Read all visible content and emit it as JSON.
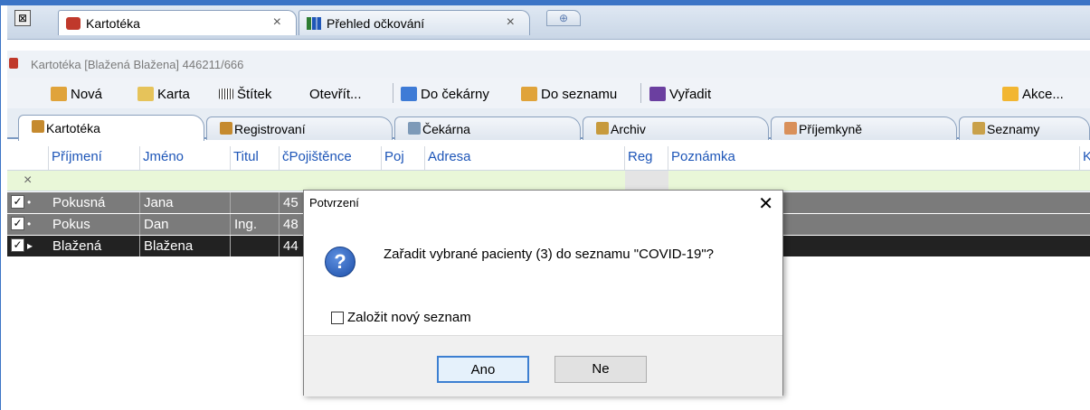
{
  "tabs": {
    "items": [
      {
        "label": "Kartotéka",
        "close": "×"
      },
      {
        "label": "Přehled očkování",
        "close": "×"
      }
    ],
    "close_all_glyph": "⊠",
    "new_tab_glyph": "⊕"
  },
  "breadcrumb": "Kartotéka [Blažená  Blažena] 446211/666",
  "toolbar": {
    "nova": "Nová",
    "karta": "Karta",
    "stitek": "Štítek",
    "otevrit": "Otevřít...",
    "do_cekarny": "Do čekárny",
    "do_seznamu": "Do seznamu",
    "vyradit": "Vyřadit",
    "akce": "Akce..."
  },
  "view_tabs": [
    "Kartotéka",
    "Registrovaní",
    "Čekárna",
    "Archiv",
    "Příjemkyně",
    "Seznamy"
  ],
  "table": {
    "filter_clear": "×",
    "columns": [
      "Příjmení",
      "Jméno",
      "Titul",
      "čPojištěnce",
      "Poj",
      "Adresa",
      "Reg",
      "Poznámka",
      "K"
    ],
    "rows": [
      {
        "check": "✓",
        "mark": "•",
        "prijmeni": "Pokusná",
        "jmeno": "Jana",
        "titul": "",
        "cpoj": "45"
      },
      {
        "check": "✓",
        "mark": "•",
        "prijmeni": "Pokus",
        "jmeno": "Dan",
        "titul": "Ing.",
        "cpoj": "48"
      },
      {
        "check": "✓",
        "mark": "▸",
        "prijmeni": "Blažená",
        "jmeno": "Blažena",
        "titul": "",
        "cpoj": "44"
      }
    ]
  },
  "dialog": {
    "title": "Potvrzení",
    "close": "✕",
    "icon": "?",
    "message": "Zařadit vybrané pacienty (3) do seznamu \"COVID-19\"?",
    "checkbox_label": "Založit nový seznam",
    "yes": "Ano",
    "no": "Ne"
  },
  "colors": {
    "frame": "#3b74c6",
    "header_text": "#1e56b8",
    "row_selected": "#7b7b7b",
    "row_current": "#222222",
    "filter_row": "#e9f7d8"
  }
}
